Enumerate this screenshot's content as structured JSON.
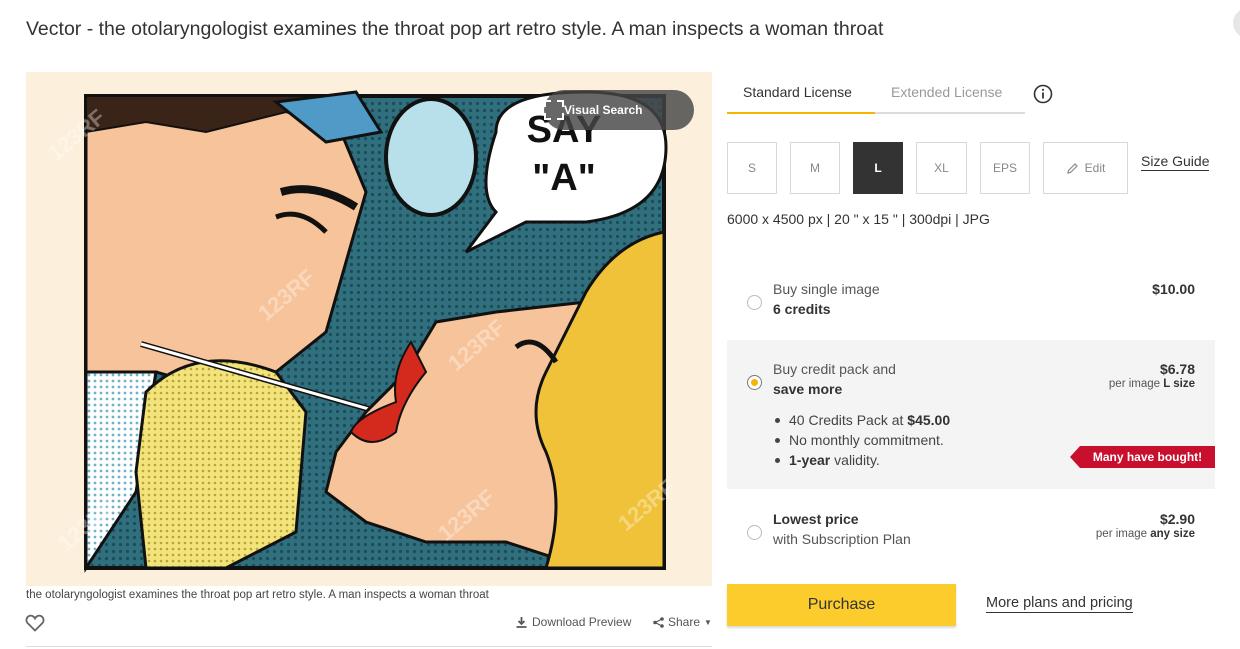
{
  "title": "Vector - the otolaryngologist examines the throat pop art retro style. A man inspects a woman throat",
  "image": {
    "visual_search_label": "Visual Search",
    "speech_bubble_text_line1": "SAY",
    "speech_bubble_text_line2": "\"A\"",
    "watermark": "123RF",
    "caption": "the otolaryngologist examines the throat pop art retro style. A man inspects a woman throat",
    "download_label": "Download Preview",
    "share_label": "Share"
  },
  "license_tabs": {
    "standard": "Standard License",
    "extended": "Extended License",
    "active": "standard"
  },
  "sizes": {
    "options": [
      "S",
      "M",
      "L",
      "XL",
      "EPS"
    ],
    "selected": "L",
    "edit_label": "Edit",
    "size_guide_label": "Size Guide",
    "dimensions": "6000 x 4500 px | 20 \" x 15 \" | 300dpi | JPG"
  },
  "purchase_options": {
    "single": {
      "line1": "Buy single image",
      "line2": "6 credits",
      "price": "$10.00"
    },
    "credit_pack": {
      "line1": "Buy credit pack and",
      "line2": "save more",
      "price": "$6.78",
      "per_prefix": "per image",
      "per_size": "L size",
      "bullet1_prefix": "40 Credits Pack at",
      "bullet1_price": "$45.00",
      "bullet2": "No monthly commitment.",
      "bullet3_bold": "1-year",
      "bullet3_rest": "validity.",
      "ribbon": "Many have bought!",
      "selected": true
    },
    "subscription": {
      "line1": "Lowest price",
      "line2": "with Subscription Plan",
      "price": "$2.90",
      "per_prefix": "per image",
      "per_size": "any size"
    }
  },
  "purchase_button": "Purchase",
  "more_plans_label": "More plans and pricing",
  "colors": {
    "accent": "#fccc2c",
    "tab_underline": "#f6b500",
    "ribbon": "#c8102e",
    "selected_size": "#333333"
  }
}
